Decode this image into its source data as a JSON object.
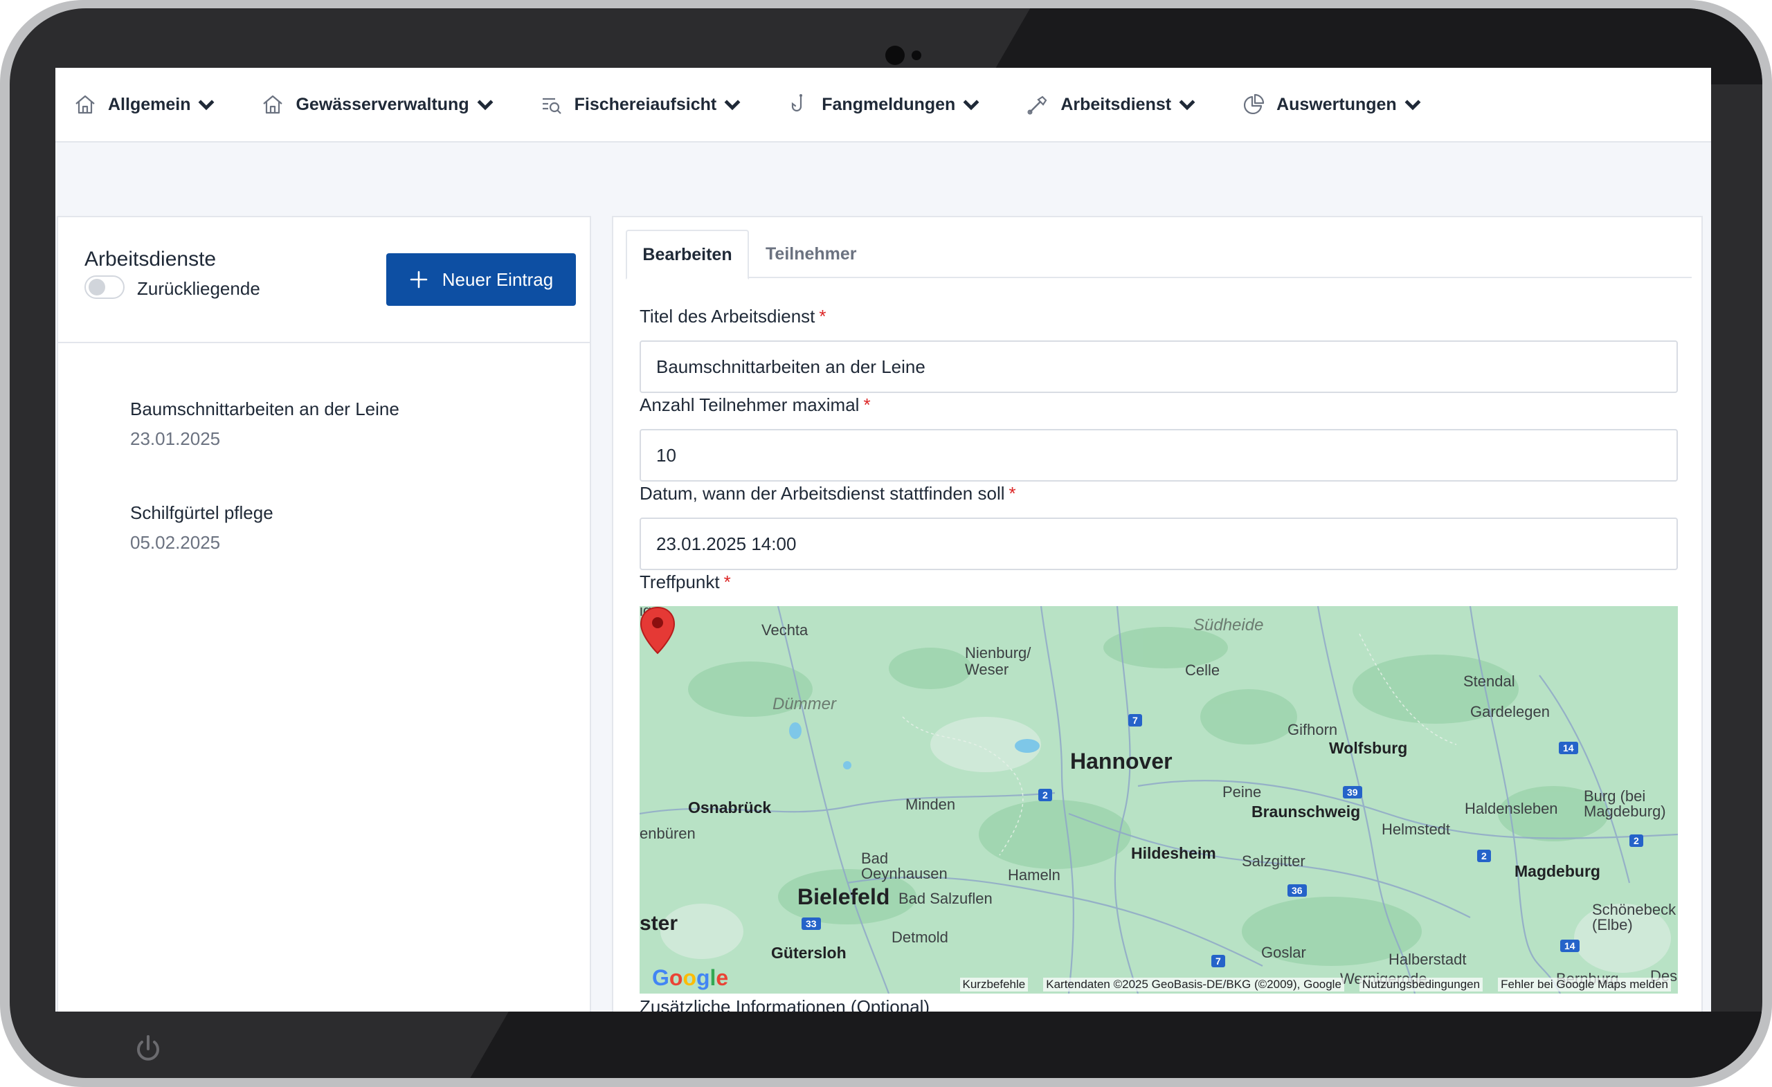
{
  "nav": {
    "items": [
      {
        "label": "Allgemein",
        "icon": "home-icon"
      },
      {
        "label": "Gewässerverwaltung",
        "icon": "home-icon"
      },
      {
        "label": "Fischereiaufsicht",
        "icon": "search-list-icon"
      },
      {
        "label": "Fangmeldungen",
        "icon": "fish-hook-icon"
      },
      {
        "label": "Arbeitsdienst",
        "icon": "tool-icon"
      },
      {
        "label": "Auswertungen",
        "icon": "pie-chart-icon"
      }
    ]
  },
  "left": {
    "title": "Arbeitsdienste",
    "toggle_label": "Zurückliegende",
    "toggle_on": false,
    "new_button": "Neuer Eintrag",
    "entries": [
      {
        "title": "Baumschnittarbeiten an der Leine",
        "date": "23.01.2025"
      },
      {
        "title": "Schilfgürtel pflege",
        "date": "05.02.2025"
      }
    ]
  },
  "right": {
    "tabs": [
      "Bearbeiten",
      "Teilnehmer"
    ],
    "active_tab": "Bearbeiten",
    "fields": {
      "title_label": "Titel des Arbeitsdienst",
      "title_value": "Baumschnittarbeiten an der Leine",
      "max_label": "Anzahl Teilnehmer maximal",
      "max_value": "10",
      "date_label": "Datum, wann der Arbeitsdienst stattfinden soll",
      "date_value": "23.01.2025 14:00",
      "meeting_label": "Treffpunkt",
      "required_mark": "*",
      "extra_label": "Zusätzliche Informationen (Optional)"
    },
    "map": {
      "cities": {
        "vechta": "Vechta",
        "nienburg": "Nienburg/\nWeser",
        "suedheide": "Südheide",
        "celle": "Celle",
        "stendal": "Stendal",
        "duemmer": "Dümmer",
        "gardelegen": "Gardelegen",
        "gifhorn": "Gifhorn",
        "wolfsburg": "Wolfsburg",
        "hannover": "Hannover",
        "osnabrueck": "Osnabrück",
        "minden": "Minden",
        "peine": "Peine",
        "braunschweig": "Braunschweig",
        "haldensleben": "Haldensleben",
        "burg": "Burg (bei\nMagdeburg)",
        "helmstedt": "Helmstedt",
        "enbueren": "enbüren",
        "hildesheim": "Hildesheim",
        "salzgitter": "Salzgitter",
        "bad_oeynhausen": "Bad\nOeynhausen",
        "hameln": "Hameln",
        "magdeburg": "Magdeburg",
        "bielefeld": "Bielefeld",
        "bad_salzuflen": "Bad Salzuflen",
        "ster": "ster",
        "schoenebeck": "Schönebeck\n(Elbe)",
        "detmold": "Detmold",
        "guetersloh": "Gütersloh",
        "goslar": "Goslar",
        "halberstadt": "Halberstadt",
        "wernigerode": "Wernigerode",
        "bernburg": "Bernburg",
        "des": "Des",
        "ig": "ig"
      },
      "shields": {
        "a7_north": "7",
        "a2_west": "2",
        "a39": "39",
        "a14_north": "14",
        "a2_east": "2",
        "a2_far_east": "2",
        "a36": "36",
        "a33": "33",
        "a7_south": "7",
        "a14_south": "14"
      },
      "google_logo": "Google",
      "footer": {
        "shortcuts": "Kurzbefehle",
        "copyright": "Kartendaten ©2025 GeoBasis-DE/BKG (©2009), Google",
        "terms": "Nutzungsbedingungen",
        "report": "Fehler bei Google Maps melden"
      }
    }
  },
  "colors": {
    "primary": "#0d4fa3",
    "required": "#dc2626",
    "map_land": "#b9e3c6",
    "pin": "#e53935"
  }
}
